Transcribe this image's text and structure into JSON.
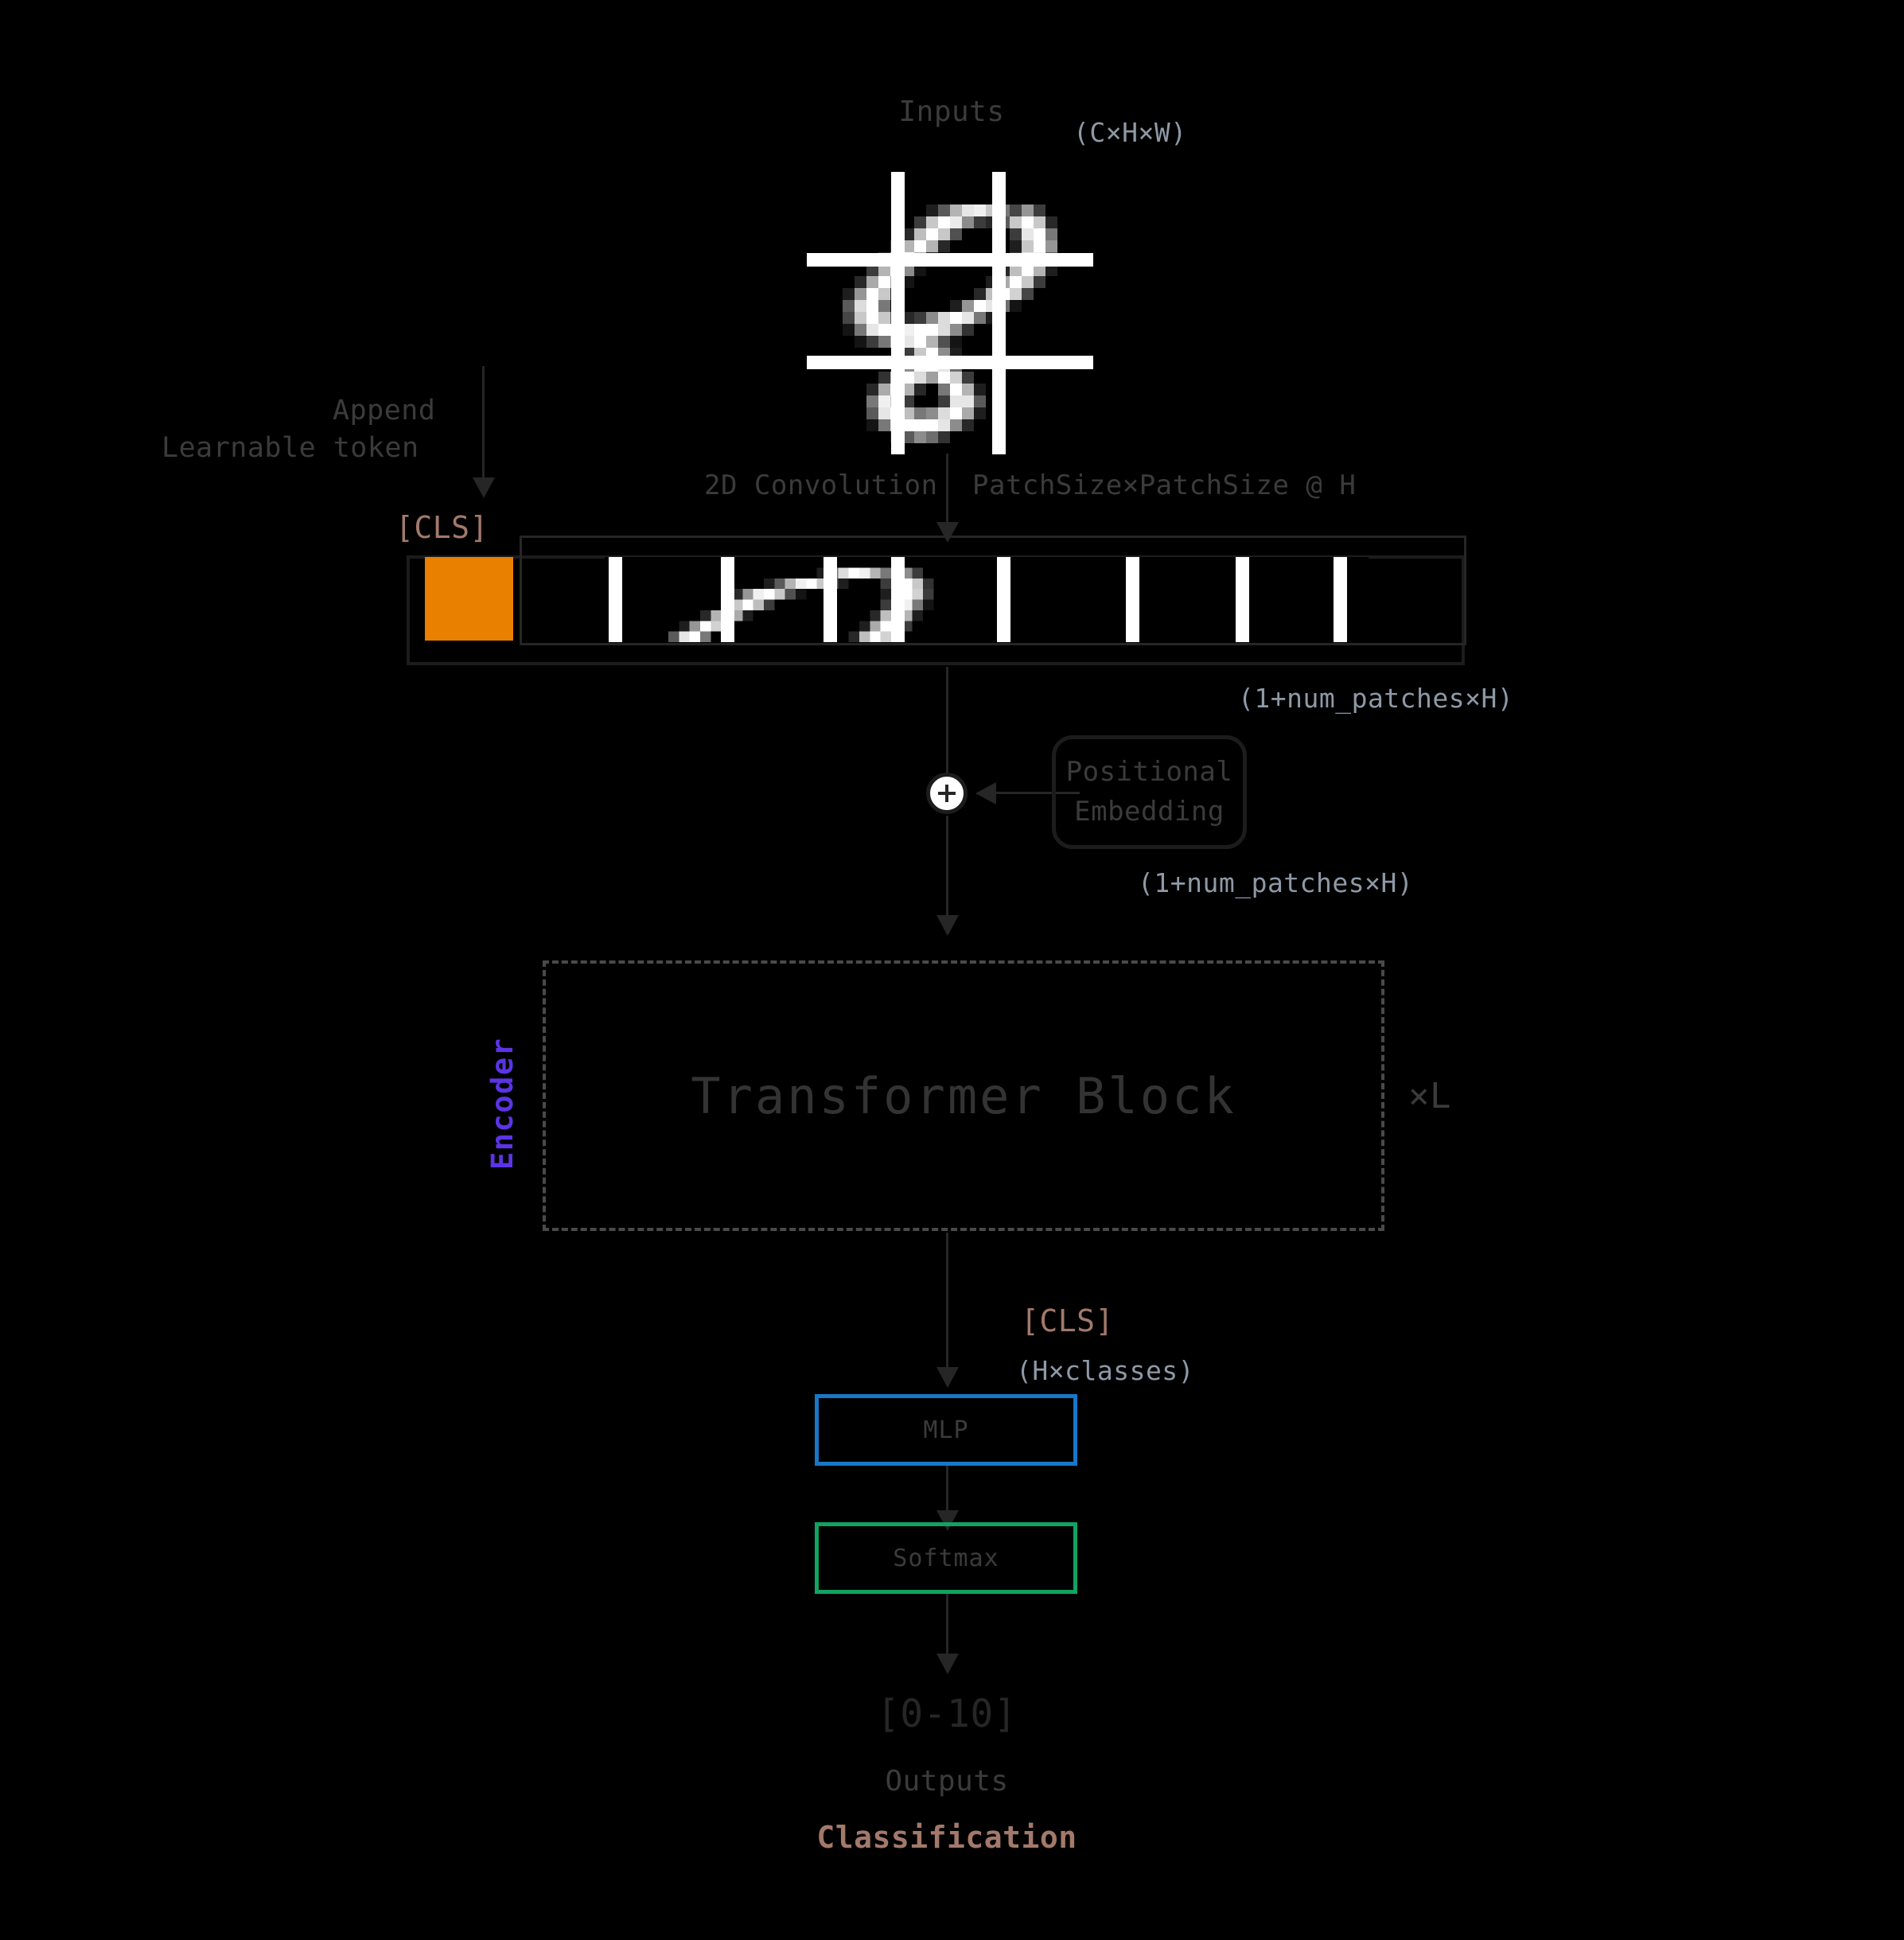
{
  "diagram": {
    "title_input": "Inputs",
    "input_shape": "(C×H×W)",
    "append_line1": "Append",
    "append_line2": "Learnable token",
    "conv_label": "2D Convolution",
    "conv_params": "PatchSize×PatchSize @ H",
    "cls_token_top": "[CLS]",
    "token_shape": "(1+num_patches×H)",
    "pos_embed_line1": "Positional",
    "pos_embed_line2": "Embedding",
    "pos_embed_shape": "(1+num_patches×H)",
    "encoder_label": "Encoder",
    "transformer_label": "Transformer Block",
    "repeat_label": "×L",
    "cls_token_bottom": "[CLS]",
    "head_shape": "(H×classes)",
    "mlp_label": "MLP",
    "softmax_label": "Softmax",
    "output_range": "[0-10]",
    "outputs_label": "Outputs",
    "classification_label": "Classification"
  },
  "colors": {
    "background": "#000000",
    "cls_square": "#e98000",
    "cls_text": "#a3796b",
    "encoder": "#5b34e6",
    "mlp_border": "#1878c8",
    "softmax_border": "#10a362",
    "shape_text": "#8e99a6",
    "body_text": "#3b3b3b",
    "line": "#262626"
  },
  "input_pixels": [
    [
      0,
      0,
      0,
      0,
      0,
      0,
      0,
      0,
      0,
      0,
      0,
      0,
      0,
      0,
      0,
      0,
      0,
      0,
      0,
      0,
      0,
      0,
      0,
      0
    ],
    [
      0,
      0,
      0,
      0,
      0,
      0,
      0,
      0,
      0,
      0,
      0,
      0,
      0,
      0,
      0,
      0,
      0,
      0,
      0,
      0,
      0,
      0,
      0,
      0
    ],
    [
      0,
      0,
      0,
      0,
      0,
      0,
      0,
      0,
      0,
      0,
      0,
      0,
      0,
      0,
      0,
      0,
      0,
      0,
      0,
      0,
      0,
      0,
      0,
      0
    ],
    [
      0,
      0,
      0,
      0,
      0,
      0,
      0,
      0,
      0,
      0,
      30,
      90,
      180,
      230,
      240,
      200,
      120,
      70,
      150,
      60,
      0,
      0,
      0,
      0
    ],
    [
      0,
      0,
      0,
      0,
      0,
      0,
      0,
      0,
      0,
      60,
      200,
      255,
      235,
      140,
      60,
      40,
      90,
      200,
      255,
      200,
      40,
      0,
      0,
      0
    ],
    [
      0,
      0,
      0,
      0,
      0,
      0,
      0,
      0,
      40,
      190,
      255,
      200,
      80,
      0,
      0,
      0,
      0,
      60,
      230,
      255,
      120,
      0,
      0,
      0
    ],
    [
      0,
      0,
      0,
      0,
      0,
      0,
      0,
      50,
      180,
      255,
      180,
      40,
      0,
      0,
      0,
      0,
      0,
      30,
      200,
      255,
      150,
      0,
      0,
      0
    ],
    [
      0,
      0,
      0,
      0,
      0,
      0,
      40,
      160,
      255,
      170,
      30,
      0,
      0,
      0,
      0,
      0,
      0,
      60,
      230,
      240,
      90,
      0,
      0,
      0
    ],
    [
      0,
      0,
      0,
      0,
      0,
      60,
      180,
      255,
      140,
      20,
      0,
      0,
      0,
      0,
      0,
      0,
      40,
      190,
      255,
      180,
      30,
      0,
      0,
      0
    ],
    [
      0,
      0,
      0,
      0,
      40,
      170,
      255,
      170,
      20,
      0,
      0,
      0,
      0,
      0,
      0,
      30,
      170,
      255,
      200,
      60,
      0,
      0,
      0,
      0
    ],
    [
      0,
      0,
      0,
      30,
      150,
      255,
      200,
      40,
      0,
      0,
      0,
      0,
      0,
      0,
      40,
      190,
      255,
      210,
      70,
      0,
      0,
      0,
      0,
      0
    ],
    [
      0,
      0,
      0,
      90,
      220,
      255,
      120,
      0,
      0,
      0,
      0,
      0,
      30,
      150,
      255,
      230,
      110,
      20,
      0,
      0,
      0,
      0,
      0,
      0
    ],
    [
      0,
      0,
      0,
      70,
      200,
      255,
      200,
      90,
      40,
      60,
      140,
      220,
      255,
      230,
      120,
      30,
      0,
      0,
      0,
      0,
      0,
      0,
      0
    ],
    [
      0,
      0,
      0,
      20,
      120,
      230,
      255,
      255,
      240,
      255,
      255,
      220,
      140,
      50,
      0,
      0,
      0,
      0,
      0,
      0,
      0,
      0,
      0
    ],
    [
      0,
      0,
      0,
      0,
      20,
      60,
      120,
      180,
      230,
      255,
      180,
      80,
      20,
      0,
      0,
      0,
      0,
      0,
      0,
      0,
      0,
      0,
      0,
      0
    ],
    [
      0,
      0,
      0,
      0,
      0,
      0,
      0,
      0,
      60,
      200,
      255,
      140,
      30,
      0,
      0,
      0,
      0,
      0,
      0,
      0,
      0,
      0,
      0,
      0
    ],
    [
      0,
      0,
      0,
      0,
      0,
      0,
      0,
      30,
      140,
      250,
      255,
      230,
      110,
      0,
      0,
      0,
      0,
      0,
      0,
      0,
      0,
      0,
      0,
      0
    ],
    [
      0,
      0,
      0,
      0,
      0,
      0,
      50,
      180,
      255,
      220,
      160,
      255,
      210,
      60,
      0,
      0,
      0,
      0,
      0,
      0,
      0,
      0,
      0,
      0
    ],
    [
      0,
      0,
      0,
      0,
      0,
      40,
      170,
      255,
      180,
      40,
      0,
      120,
      255,
      180,
      30,
      0,
      0,
      0,
      0,
      0,
      0,
      0,
      0,
      0
    ],
    [
      0,
      0,
      0,
      0,
      0,
      120,
      240,
      200,
      60,
      0,
      0,
      60,
      230,
      230,
      90,
      0,
      0,
      0,
      0,
      0,
      0,
      0,
      0,
      0
    ],
    [
      0,
      0,
      0,
      0,
      0,
      90,
      230,
      255,
      190,
      120,
      140,
      220,
      255,
      170,
      30,
      0,
      0,
      0,
      0,
      0,
      0,
      0,
      0,
      0
    ],
    [
      0,
      0,
      0,
      0,
      0,
      20,
      120,
      220,
      255,
      255,
      255,
      230,
      140,
      40,
      0,
      0,
      0,
      0,
      0,
      0,
      0,
      0,
      0,
      0
    ],
    [
      0,
      0,
      0,
      0,
      0,
      0,
      0,
      30,
      90,
      140,
      110,
      50,
      0,
      0,
      0,
      0,
      0,
      0,
      0,
      0,
      0,
      0,
      0,
      0
    ],
    [
      0,
      0,
      0,
      0,
      0,
      0,
      0,
      0,
      0,
      0,
      0,
      0,
      0,
      0,
      0,
      0,
      0,
      0,
      0,
      0,
      0,
      0,
      0,
      0
    ]
  ],
  "patch_row_pixels": [
    [
      0,
      0,
      0,
      0,
      0,
      0,
      0,
      0,
      0,
      0,
      0,
      0,
      0,
      0,
      0,
      0,
      0,
      0,
      0,
      0,
      0,
      0,
      0,
      0,
      0,
      0,
      0,
      0,
      0,
      0,
      0,
      0,
      0,
      0,
      0,
      0,
      0,
      0,
      0,
      0,
      0,
      0,
      0,
      0,
      0,
      0,
      0,
      0,
      0,
      0,
      0,
      0,
      0,
      0,
      0,
      0,
      0,
      0,
      0,
      0,
      0,
      0,
      0,
      0,
      0,
      0,
      0,
      0,
      0,
      0,
      0,
      0
    ],
    [
      0,
      0,
      0,
      0,
      0,
      0,
      0,
      0,
      0,
      0,
      0,
      0,
      0,
      0,
      0,
      0,
      0,
      0,
      0,
      0,
      30,
      120,
      220,
      255,
      240,
      180,
      120,
      200,
      140,
      60,
      0,
      0,
      0,
      0,
      0,
      0,
      0,
      0,
      0,
      0,
      0,
      0,
      0,
      0,
      0,
      0,
      0,
      0,
      0,
      0,
      0,
      0,
      0,
      0,
      0,
      0,
      0,
      0,
      0,
      0,
      0,
      0,
      0,
      0,
      0,
      0,
      0,
      0,
      0,
      0,
      0,
      0
    ],
    [
      0,
      0,
      0,
      0,
      0,
      0,
      0,
      0,
      0,
      0,
      0,
      0,
      0,
      0,
      0,
      30,
      90,
      180,
      240,
      255,
      200,
      90,
      30,
      0,
      0,
      0,
      60,
      230,
      255,
      200,
      50,
      0,
      0,
      0,
      0,
      0,
      0,
      0,
      0,
      0,
      0,
      0,
      0,
      0,
      0,
      0,
      0,
      0,
      0,
      0,
      0,
      0,
      0,
      0,
      0,
      0,
      0,
      0,
      0,
      0,
      0,
      0,
      0,
      0,
      0,
      0,
      0,
      0,
      0,
      0,
      0,
      0
    ],
    [
      0,
      0,
      0,
      0,
      0,
      0,
      0,
      0,
      0,
      0,
      0,
      0,
      40,
      150,
      240,
      255,
      200,
      80,
      20,
      0,
      0,
      0,
      0,
      0,
      0,
      0,
      30,
      200,
      255,
      210,
      60,
      0,
      0,
      0,
      0,
      0,
      0,
      0,
      0,
      0,
      0,
      0,
      0,
      0,
      0,
      0,
      0,
      0,
      0,
      0,
      0,
      0,
      0,
      0,
      0,
      0,
      0,
      0,
      0,
      0,
      0,
      0,
      0,
      0,
      0,
      0,
      0,
      0,
      0,
      0,
      0,
      0
    ],
    [
      0,
      0,
      0,
      0,
      0,
      0,
      0,
      0,
      0,
      0,
      0,
      50,
      200,
      255,
      190,
      60,
      0,
      0,
      0,
      0,
      0,
      0,
      0,
      0,
      0,
      0,
      60,
      230,
      240,
      120,
      20,
      0,
      0,
      0,
      0,
      0,
      0,
      0,
      0,
      0,
      0,
      0,
      0,
      0,
      0,
      0,
      0,
      0,
      0,
      0,
      0,
      0,
      0,
      0,
      0,
      0,
      0,
      0,
      0,
      0,
      0,
      0,
      0,
      0,
      0,
      0,
      0,
      0,
      0,
      0,
      0,
      0
    ],
    [
      0,
      0,
      0,
      0,
      0,
      0,
      0,
      0,
      0,
      40,
      180,
      255,
      170,
      30,
      0,
      0,
      0,
      0,
      0,
      0,
      0,
      0,
      0,
      0,
      0,
      40,
      190,
      255,
      180,
      30,
      0,
      0,
      0,
      0,
      0,
      0,
      0,
      0,
      0,
      0,
      0,
      0,
      0,
      0,
      0,
      0,
      0,
      0,
      0,
      0,
      0,
      0,
      0,
      0,
      0,
      0,
      0,
      0,
      0,
      0,
      0,
      0,
      0,
      0,
      0,
      0,
      0,
      0,
      0,
      0,
      0,
      0
    ],
    [
      0,
      0,
      0,
      0,
      0,
      0,
      0,
      30,
      150,
      255,
      210,
      60,
      0,
      0,
      0,
      0,
      0,
      0,
      0,
      0,
      0,
      0,
      0,
      0,
      30,
      170,
      255,
      200,
      60,
      0,
      0,
      0,
      0,
      0,
      0,
      0,
      0,
      0,
      0,
      0,
      0,
      0,
      0,
      0,
      0,
      0,
      0,
      0,
      0,
      0,
      0,
      0,
      0,
      0,
      0,
      0,
      0,
      0,
      0,
      0,
      0,
      0,
      0,
      0,
      0,
      0,
      0,
      0,
      0,
      0,
      0,
      0
    ],
    [
      0,
      0,
      0,
      0,
      0,
      0,
      90,
      230,
      255,
      120,
      0,
      0,
      0,
      0,
      0,
      0,
      0,
      0,
      0,
      0,
      0,
      0,
      0,
      40,
      190,
      255,
      210,
      70,
      0,
      0,
      0,
      0,
      0,
      0,
      0,
      0,
      0,
      0,
      0,
      0,
      0,
      0,
      0,
      0,
      0,
      0,
      0,
      0,
      0,
      0,
      0,
      0,
      0,
      0,
      0,
      0,
      0,
      0,
      0,
      0,
      0,
      0,
      0,
      0,
      0,
      0,
      0,
      0,
      0,
      0,
      0,
      0
    ]
  ]
}
